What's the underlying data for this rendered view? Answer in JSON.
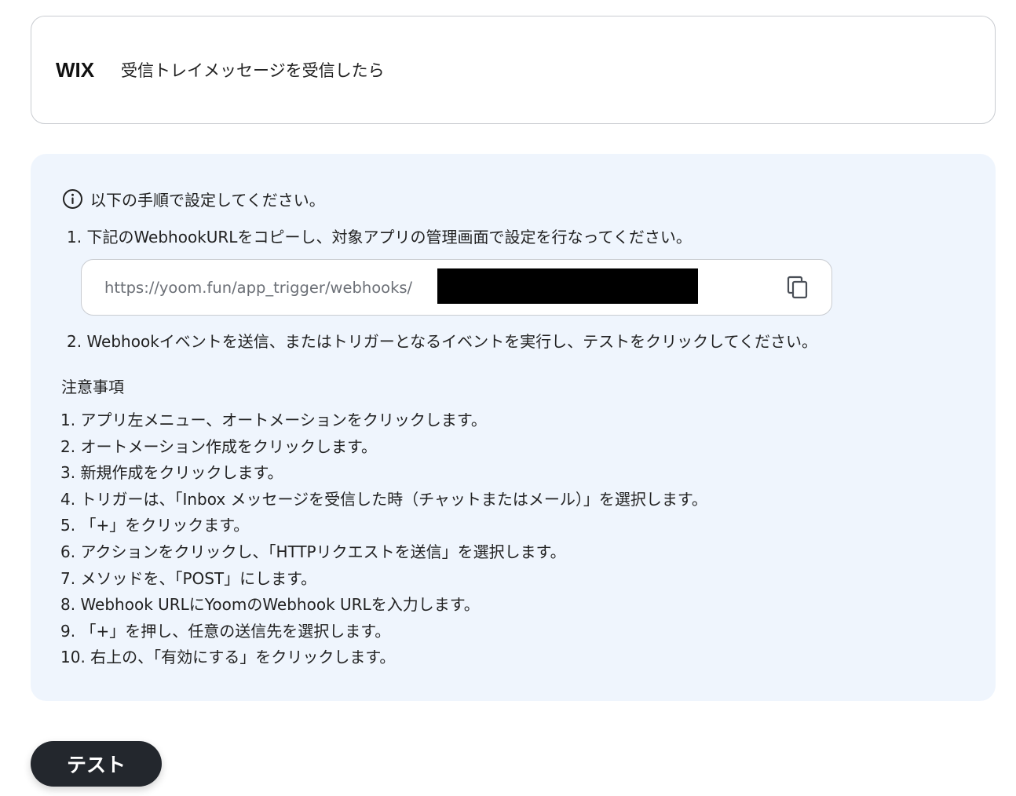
{
  "trigger": {
    "app_logo": "WIX",
    "title": "受信トレイメッセージを受信したら"
  },
  "instructions": {
    "info_icon": "info-circle-icon",
    "heading": "以下の手順で設定してください。",
    "step1": "1. 下記のWebhookURLをコピーし、対象アプリの管理画面で設定を行なってください。",
    "webhook_url": "https://yoom.fun/app_trigger/webhooks/",
    "copy_icon": "copy-icon",
    "step2": "2. Webhookイベントを送信、またはトリガーとなるイベントを実行し、テストをクリックしてください。"
  },
  "notes": {
    "title": "注意事項",
    "items": [
      "1. アプリ左メニュー、オートメーションをクリックします。",
      "2. オートメーション作成をクリックします。",
      "3. 新規作成をクリックします。",
      "4. トリガーは、「Inbox メッセージを受信した時（チャットまたはメール）」を選択します。",
      "5. 「+」をクリックます。",
      "6. アクションをクリックし、「HTTPリクエストを送信」を選択します。",
      "7. メソッドを、「POST」にします。",
      "8. Webhook URLにYoomのWebhook URLを入力します。",
      "9. 「+」を押し、任意の送信先を選択します。",
      "10. 右上の、「有効にする」をクリックします。"
    ]
  },
  "actions": {
    "test_label": "テスト"
  },
  "colors": {
    "panel_bg": "#eff5fd",
    "button_bg": "#23272d",
    "border": "#c9ccd1"
  }
}
